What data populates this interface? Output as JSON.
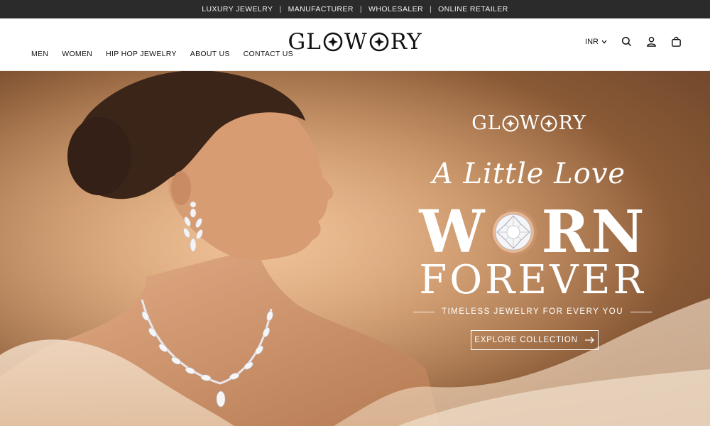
{
  "announcement": {
    "items": [
      "LUXURY JEWELRY",
      "MANUFACTURER",
      "WHOLESALER",
      "ONLINE RETAILER"
    ],
    "separator": "|"
  },
  "header": {
    "logo_left": "GL",
    "logo_mid": "W",
    "logo_right": "RY",
    "nav": [
      "MEN",
      "WOMEN",
      "HIP HOP JEWELRY",
      "ABOUT US",
      "CONTACT US"
    ],
    "currency": "INR",
    "icons": [
      "search-icon",
      "account-icon",
      "cart-icon"
    ]
  },
  "hero": {
    "logo_left": "GL",
    "logo_mid": "W",
    "logo_right": "RY",
    "script_line": "A Little Love",
    "headline_left": "W",
    "headline_right": "RN",
    "headline_2": "FOREVER",
    "tagline": "TIMELESS JEWELRY FOR EVERY YOU",
    "cta_label": "EXPLORE COLLECTION",
    "cta_icon": "arrow-right-icon"
  },
  "colors": {
    "topbar_bg": "#2b2b2b",
    "hero_warm": "#b27a4e",
    "text_on_hero": "#ffffff",
    "ring_gold": "#c9926a"
  }
}
